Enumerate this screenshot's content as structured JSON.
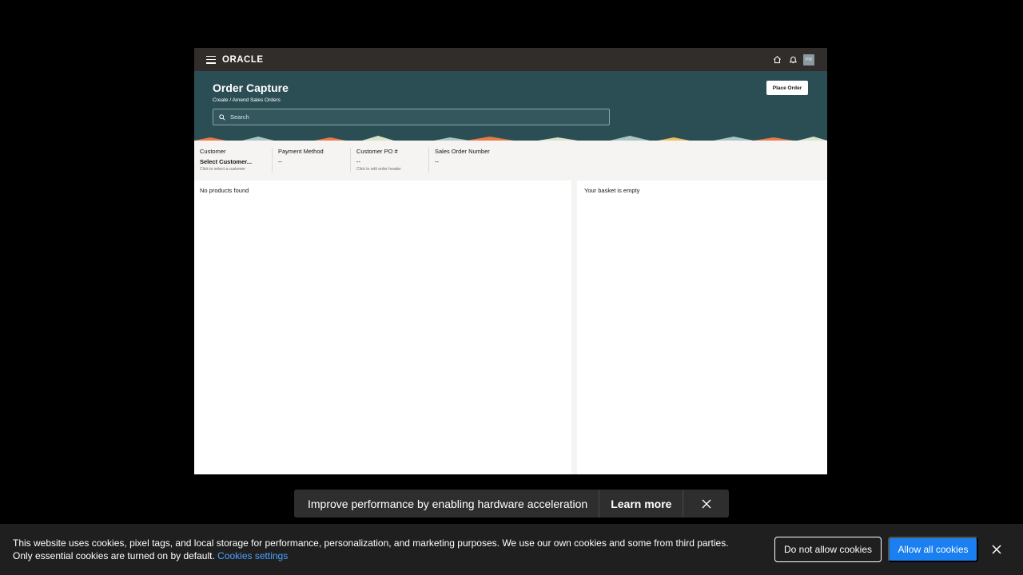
{
  "topbar": {
    "logo": "ORACLE",
    "avatar_initials": "PW"
  },
  "header": {
    "title": "Order Capture",
    "subtitle": "Create / Amend Sales Orders",
    "place_order_label": "Place Order",
    "search_placeholder": "Search"
  },
  "order_info": {
    "customer": {
      "label": "Customer",
      "value": "Select Customer...",
      "hint": "Click to select a customer"
    },
    "payment_method": {
      "label": "Payment Method",
      "value": "--"
    },
    "customer_po": {
      "label": "Customer PO #",
      "value": "--",
      "hint": "Click to edit order header"
    },
    "sales_order_number": {
      "label": "Sales Order Number",
      "value": "--"
    }
  },
  "products": {
    "empty_text": "No products found"
  },
  "basket": {
    "empty_text": "Your basket is empty"
  },
  "toast": {
    "message": "Improve performance by enabling hardware acceleration",
    "learn_more": "Learn more"
  },
  "cookie_banner": {
    "text": "This website uses cookies, pixel tags, and local storage for performance, personalization, and marketing purposes. We use our own cookies and some from third parties. Only essential cookies are turned on by default.",
    "settings_link": "Cookies settings",
    "deny_label": "Do not allow cookies",
    "allow_label": "Allow all cookies"
  },
  "colors": {
    "topbar": "#312d2a",
    "hero": "#2b4e55",
    "accent_blue": "#1a7ff0"
  }
}
